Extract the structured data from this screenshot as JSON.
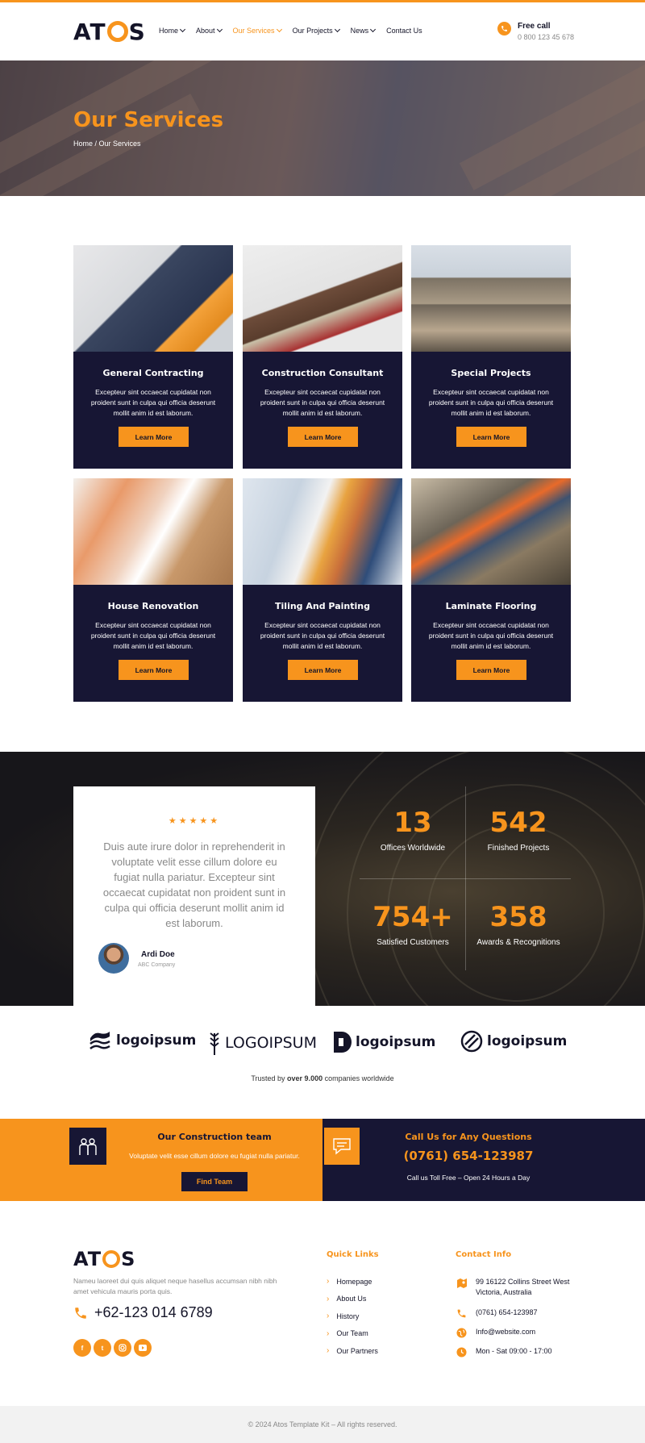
{
  "brand": {
    "name_left": "AT",
    "name_right": "S",
    "accent": "#f7941d",
    "dark": "#171634"
  },
  "nav": {
    "items": [
      {
        "label": "Home",
        "has_dropdown": true
      },
      {
        "label": "About",
        "has_dropdown": true
      },
      {
        "label": "Our Services",
        "has_dropdown": true,
        "active": true
      },
      {
        "label": "Our Projects",
        "has_dropdown": true
      },
      {
        "label": "News",
        "has_dropdown": true
      },
      {
        "label": "Contact Us",
        "has_dropdown": false
      }
    ]
  },
  "header_call": {
    "title": "Free call",
    "number": "0 800 123 45 678",
    "icon": "phone-icon"
  },
  "hero": {
    "title": "Our Services",
    "breadcrumb": "Home / Our Services"
  },
  "services": [
    {
      "title": "General Contracting",
      "text": "Excepteur sint occaecat cupidatat non proident sunt in culpa qui officia deserunt mollit anim id est laborum.",
      "button": "Learn More"
    },
    {
      "title": "Construction Consultant",
      "text": "Excepteur sint occaecat cupidatat non proident sunt in culpa qui officia deserunt mollit anim id est laborum.",
      "button": "Learn More"
    },
    {
      "title": "Special Projects",
      "text": "Excepteur sint occaecat cupidatat non proident sunt in culpa qui officia deserunt mollit anim id est laborum.",
      "button": "Learn More"
    },
    {
      "title": "House Renovation",
      "text": "Excepteur sint occaecat cupidatat non proident sunt in culpa qui officia deserunt mollit anim id est laborum.",
      "button": "Learn More"
    },
    {
      "title": "Tiling And Painting",
      "text": "Excepteur sint occaecat cupidatat non proident sunt in culpa qui officia deserunt mollit anim id est laborum.",
      "button": "Learn More"
    },
    {
      "title": "Laminate Flooring",
      "text": "Excepteur sint occaecat cupidatat non proident sunt in culpa qui officia deserunt mollit anim id est laborum.",
      "button": "Learn More"
    }
  ],
  "testimonial": {
    "rating": 5,
    "stars": "★★★★★",
    "quote": "Duis aute irure dolor in reprehenderit in voluptate velit esse cillum dolore eu fugiat nulla pariatur. Excepteur sint occaecat cupidatat non proident sunt in culpa qui officia deserunt mollit anim id est laborum.",
    "name": "Ardi Doe",
    "company": "ABC Company"
  },
  "stats": [
    {
      "value": "13",
      "label": "Offices Worldwide"
    },
    {
      "value": "542",
      "label": "Finished Projects"
    },
    {
      "value": "754+",
      "label": "Satisfied Customers"
    },
    {
      "value": "358",
      "label": "Awards & Recognitions"
    }
  ],
  "partners": [
    {
      "text": "logoipsum",
      "icon": "waves-logo-icon"
    },
    {
      "text": "LOGOIPSUM",
      "icon": "wheat-logo-icon"
    },
    {
      "text": "logoipsum",
      "icon": "d-shape-logo-icon"
    },
    {
      "text": "logoipsum",
      "icon": "circle-stripes-logo-icon"
    }
  ],
  "trusted": {
    "prefix": "Trusted by ",
    "bold": "over 9.000",
    "suffix": " companies worldwide"
  },
  "cta_team": {
    "title": "Our Construction team",
    "text": "Voluptate velit esse cillum dolore eu fugiat nulla pariatur.",
    "button": "Find Team"
  },
  "cta_call": {
    "title": "Call Us for Any Questions",
    "phone": "(0761) 654-123987",
    "sub": "Call us Toll Free – Open 24 Hours a Day"
  },
  "footer": {
    "description": "Nameu laoreet dui quis aliquet neque hasellus accumsan nibh nibh amet vehicula mauris porta quis.",
    "phone": "+62-123 014 6789",
    "socials": [
      "facebook-icon",
      "twitter-icon",
      "instagram-icon",
      "youtube-icon"
    ],
    "quick_links_title": "Quick Links",
    "quick_links": [
      "Homepage",
      "About Us",
      "History",
      "Our Team",
      "Our Partners"
    ],
    "contact_title": "Contact Info",
    "contact": [
      {
        "icon": "map-icon",
        "text": "99 16122 Collins Street West Victoria, Australia"
      },
      {
        "icon": "phone-icon",
        "text": "(0761) 654-123987"
      },
      {
        "icon": "globe-icon",
        "text": "Info@website.com"
      },
      {
        "icon": "clock-icon",
        "text": "Mon - Sat 09:00 - 17:00"
      }
    ],
    "copyright": "© 2024 Atos Template Kit – All rights reserved."
  }
}
